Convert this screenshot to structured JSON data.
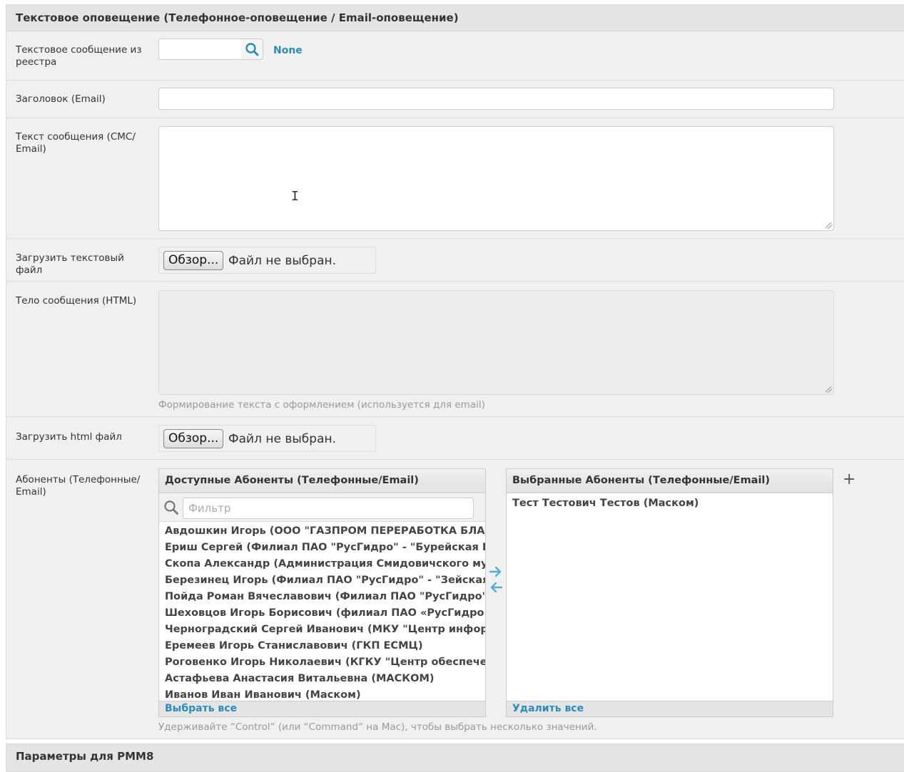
{
  "section_main": {
    "title": "Текстовое оповещение (Телефонное-оповещение / Email-оповещение)"
  },
  "fields": {
    "registry_message": {
      "label": "Текстовое сообщение из реестра",
      "value": "",
      "lookup_value": "None"
    },
    "email_subject": {
      "label": "Заголовок (Email)",
      "value": ""
    },
    "message_text": {
      "label": "Текст сообщения (СМС/ Email)",
      "value": ""
    },
    "text_file": {
      "label": "Загрузить текстовый файл",
      "button": "Обзор...",
      "status": "Файл не выбран."
    },
    "html_body": {
      "label": "Тело сообщения (HTML)",
      "value": "",
      "help": "Формирование текста с оформлением (используется для email)"
    },
    "html_file": {
      "label": "Загрузить html файл",
      "button": "Обзор...",
      "status": "Файл не выбран."
    },
    "subscribers": {
      "label": "Абоненты (Телефонные/ Email)",
      "available_title": "Доступные Абоненты (Телефонные/Email)",
      "filter_placeholder": "Фильтр",
      "available": [
        "Авдошкин Игорь (ООО \"ГАЗПРОМ ПЕРЕРАБОТКА БЛАГОВЕЩЕНСК\")",
        "Ериш Сергей (Филиал ПАО \"РусГидро\" - \"Бурейская ГЭС\")",
        "Скопа Александр (Администрация Смидовичского муниципального района)",
        "Березинец Игорь (Филиал ПАО \"РусГидро\" - \"Зейская ГЭС\")",
        "Пойда Роман Вячеславович (Филиал ПАО \"РусГидро\" - \"Зейская ГЭС\")",
        "Шеховцов Игорь Борисович (филиал ПАО «РусГидро» - «Бурейская ГЭС»)",
        "Черноградский Сергей Иванович (МКУ \"Центр информационного обеспечения\")",
        "Еремеев Игорь Станиславович (ГКП ЕСМЦ)",
        "Роговенко Игорь Николаевич (КГКУ \"Центр обеспечения деятельности\")",
        "Астафьева Анастасия Витальевна (МАСКОМ)",
        "Иванов Иван Иванович (Маском)"
      ],
      "select_all": "Выбрать все",
      "chosen_title": "Выбранные Абоненты (Телефонные/Email)",
      "chosen": [
        "Тест Тестович Тестов (Маском)"
      ],
      "remove_all": "Удалить все",
      "help": "Удерживайте “Control“ (или “Command“ на Mac), чтобы выбрать несколько значений.",
      "add_symbol": "+"
    }
  },
  "section_next": {
    "title": "Параметры для PMM8"
  },
  "colors": {
    "accent": "#2a8cbd",
    "arrow": "#4fb0d6",
    "background": "#f0f0f0",
    "header": "#e4e4e4"
  },
  "icons": [
    "search-icon",
    "arrow-right-icon",
    "arrow-left-icon",
    "plus-icon",
    "text-cursor-icon",
    "resize-grip-icon"
  ]
}
